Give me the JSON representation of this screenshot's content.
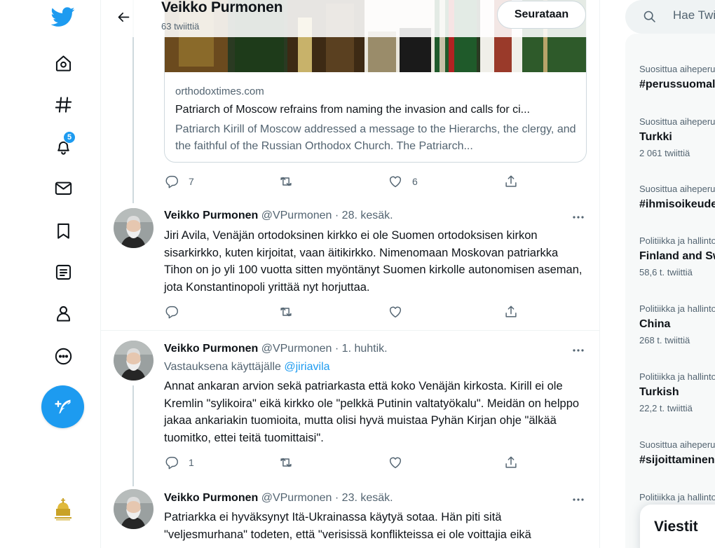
{
  "nav": {
    "notifications_badge": "5",
    "items": [
      "twitter-logo",
      "home",
      "explore",
      "notifications",
      "messages",
      "bookmarks",
      "lists",
      "profile",
      "more"
    ]
  },
  "header": {
    "name": "Veikko Purmonen",
    "tweet_count": "63 twiittiä",
    "follow_label": "Seurataan"
  },
  "card": {
    "domain": "orthodoxtimes.com",
    "title": "Patriarch of Moscow refrains from naming the invasion and calls for ci...",
    "description": "Patriarch Kirill of Moscow addressed a message to the Hierarchs, the clergy, and the faithful of the Russian Orthodox Church. The Patriarch..."
  },
  "card_actions": {
    "replies": "7",
    "retweets": "",
    "likes": "6"
  },
  "tweets": [
    {
      "name": "Veikko Purmonen",
      "meta": "@VPurmonen · 28. kesäk.",
      "text": "Jiri Avila, Venäjän ortodoksinen kirkko ei ole Suomen ortodoksisen kirkon sisarkirkko, kuten kirjoitat, vaan äitikirkko. Nimenomaan Moskovan patriarkka Tihon on jo yli 100 vuotta sitten myöntänyt Suomen kirkolle autonomisen aseman, jota Konstantinopoli yrittää nyt horjuttaa.",
      "replies": "",
      "retweets": "",
      "likes": ""
    },
    {
      "name": "Veikko Purmonen",
      "meta": "@VPurmonen · 1. huhtik.",
      "reply_prefix": "Vastauksena käyttäjälle",
      "reply_mention": "@jiriavila",
      "text": "Annat ankaran arvion sekä patriarkasta että koko Venäjän kirkosta. Kirill ei ole Kremlin \"sylikoira\" eikä kirkko ole \"pelkkä Putinin valtatyökalu\". Meidän on helppo jakaa ankariakin tuomioita, mutta olisi hyvä muistaa Pyhän Kirjan ohje \"älkää tuomitko, ettei teitä tuomittaisi\".",
      "replies": "1",
      "retweets": "",
      "likes": ""
    },
    {
      "name": "Veikko Purmonen",
      "meta": "@VPurmonen · 23. kesäk.",
      "text": "Patriarkka ei hyväksynyt Itä-Ukrainassa käytyä sotaa. Hän piti sitä \"veljesmurhana\" todeten, että \"verisissä konflikteissa ei ole voittajia eikä"
    }
  ],
  "search": {
    "placeholder": "Hae Twitteristä"
  },
  "trends": [
    {
      "context": "Suosittua aiheperusteisesti",
      "topic": "#perussuomalaiset",
      "count": ""
    },
    {
      "context": "Suosittua aiheperusteisesti",
      "topic": "Turkki",
      "count": "2 061 twiittiä"
    },
    {
      "context": "Suosittua aiheperusteisesti",
      "topic": "#ihmisoikeudet",
      "count": ""
    },
    {
      "context": "Politiikka ja hallinto",
      "topic": "Finland and Sweden",
      "count": "58,6 t. twiittiä"
    },
    {
      "context": "Politiikka ja hallinto",
      "topic": "China",
      "count": "268 t. twiittiä"
    },
    {
      "context": "Politiikka ja hallinto",
      "topic": "Turkish",
      "count": "22,2 t. twiittiä"
    },
    {
      "context": "Suosittua aiheperusteisesti",
      "topic": "#sijoittaminen",
      "count": ""
    },
    {
      "context": "Politiikka ja hallinto",
      "topic": "",
      "count": ""
    }
  ],
  "messages": {
    "title": "Viestit"
  },
  "colors": {
    "accent": "#1d9bf0",
    "text": "#0f1419",
    "secondary": "#536471",
    "border": "#cfd9de"
  }
}
